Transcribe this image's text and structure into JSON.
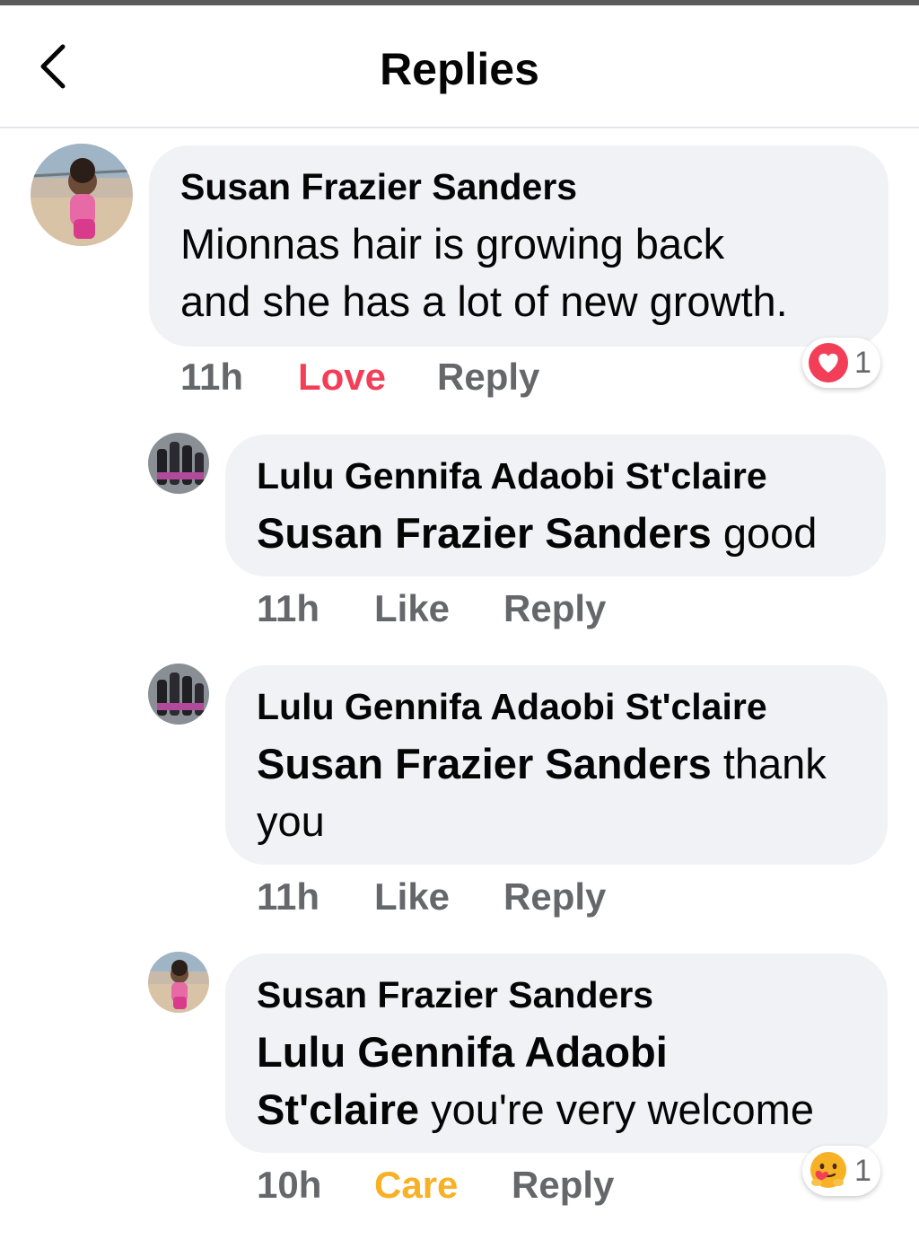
{
  "header": {
    "title": "Replies",
    "back_icon": "chevron-left-icon"
  },
  "comments": [
    {
      "author": "Susan Frazier Sanders",
      "text_line1": "Mionnas hair is growing back",
      "text_line2": "and she has a lot of new growth.",
      "time": "11h",
      "reaction_label": "Love",
      "reply_label": "Reply",
      "reaction_icon": "heart-icon",
      "reaction_count": "1",
      "reaction_color": "#f33e58"
    },
    {
      "author": "Lulu Gennifa Adaobi St'claire",
      "mention": "Susan Frazier Sanders",
      "text": " good",
      "time": "11h",
      "like_label": "Like",
      "reply_label": "Reply"
    },
    {
      "author": "Lulu Gennifa Adaobi St'claire",
      "mention": "Susan Frazier Sanders",
      "text": " thank",
      "text_line2": "you",
      "time": "11h",
      "like_label": "Like",
      "reply_label": "Reply"
    },
    {
      "author": "Susan Frazier Sanders",
      "mention_line1": "Lulu Gennifa Adaobi",
      "mention_line2": "St'claire",
      "text": " you're very welcome",
      "time": "10h",
      "reaction_label": "Care",
      "reply_label": "Reply",
      "reaction_icon": "care-hug-emoji-icon",
      "reaction_count": "1",
      "reaction_color": "#f7b125"
    }
  ]
}
